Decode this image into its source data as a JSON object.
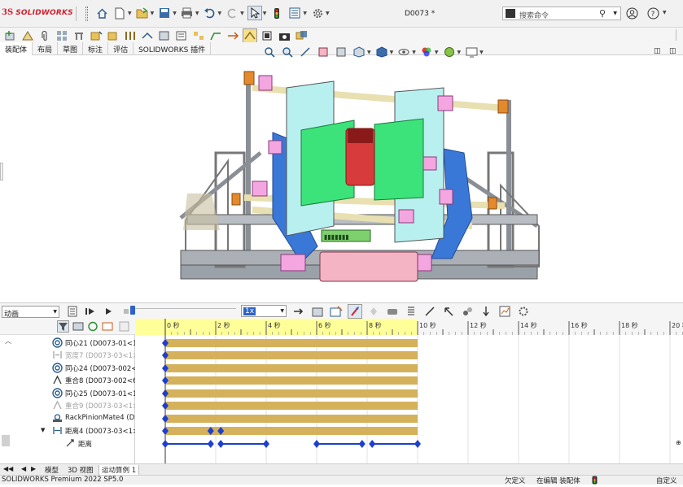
{
  "app": {
    "brand_prefix": "3S",
    "brand_name": "SOLIDWORKS",
    "document_title": "D0073 *"
  },
  "search": {
    "placeholder": "搜索命令"
  },
  "command_tabs": [
    {
      "label": "装配体",
      "active": true
    },
    {
      "label": "布局",
      "active": false
    },
    {
      "label": "草图",
      "active": false
    },
    {
      "label": "标注",
      "active": false
    },
    {
      "label": "评估",
      "active": false
    },
    {
      "label": "SOLIDWORKS 插件",
      "active": false
    }
  ],
  "motion": {
    "study_type": "动画",
    "playback_speed": "1x",
    "timeline_ticks": [
      "0 秒",
      "2 秒",
      "4 秒",
      "6 秒",
      "8 秒",
      "10 秒",
      "12 秒",
      "14 秒",
      "16 秒",
      "18 秒",
      "20 秒"
    ],
    "tree_items": [
      {
        "label": "同心21 (D0073-01<1",
        "icon": "concentric-mate-icon",
        "dim": false
      },
      {
        "label": "宽度7 (D0073-03<1>",
        "icon": "width-mate-icon",
        "dim": true
      },
      {
        "label": "同心24 (D0073-002<",
        "icon": "concentric-mate-icon",
        "dim": false
      },
      {
        "label": "重合8 (D0073-002<6",
        "icon": "coincident-mate-icon",
        "dim": false
      },
      {
        "label": "同心25 (D0073-01<1",
        "icon": "concentric-mate-icon",
        "dim": false
      },
      {
        "label": "重合9 (D0073-03<1>",
        "icon": "coincident-mate-icon",
        "dim": true
      },
      {
        "label": "RackPinionMate4 (D",
        "icon": "rack-pinion-mate-icon",
        "dim": false
      },
      {
        "label": "距离4 (D0073-03<1>",
        "icon": "distance-mate-icon",
        "dim": false
      },
      {
        "label": "距离",
        "icon": "distance-value-icon",
        "dim": false
      }
    ]
  },
  "bottom_tabs": [
    {
      "label": "模型",
      "active": false
    },
    {
      "label": "3D 视图",
      "active": false
    },
    {
      "label": "运动算例 1",
      "active": true
    }
  ],
  "status": {
    "product": "SOLIDWORKS Premium 2022 SP5.0",
    "state": "欠定义",
    "mode": "在编辑 装配体",
    "units": "自定义"
  },
  "colors": {
    "brand_red": "#d1202f",
    "timeline_bar": "#d4b15a",
    "timeline_key": "#1d3fcf",
    "timeline_header": "#ffff99"
  }
}
